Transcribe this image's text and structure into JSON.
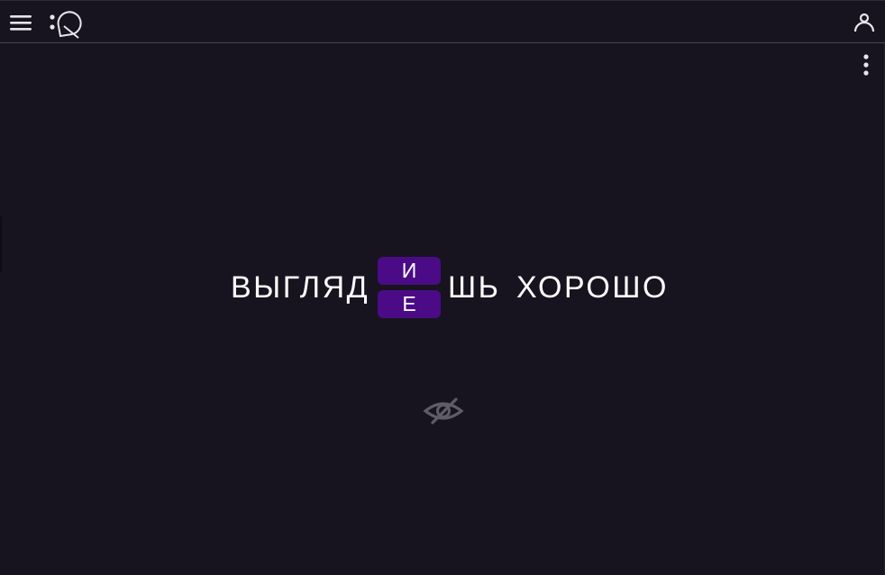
{
  "header": {
    "menu_icon": "hamburger-menu-icon",
    "logo_icon": "app-logo-icon",
    "user_icon": "user-account-icon"
  },
  "toolbar": {
    "more_icon": "more-vertical-icon"
  },
  "exercise": {
    "word_prefix": "ВЫГЛЯД",
    "choices": [
      "И",
      "Е"
    ],
    "word_suffix": "ШЬ",
    "next_word": "ХОРОШО"
  },
  "controls": {
    "hide_icon": "eye-off-icon"
  },
  "colors": {
    "background": "#17141f",
    "choice_bg": "#4b0b86",
    "icon": "#e6e4ec",
    "muted_icon": "#5f5b69"
  }
}
